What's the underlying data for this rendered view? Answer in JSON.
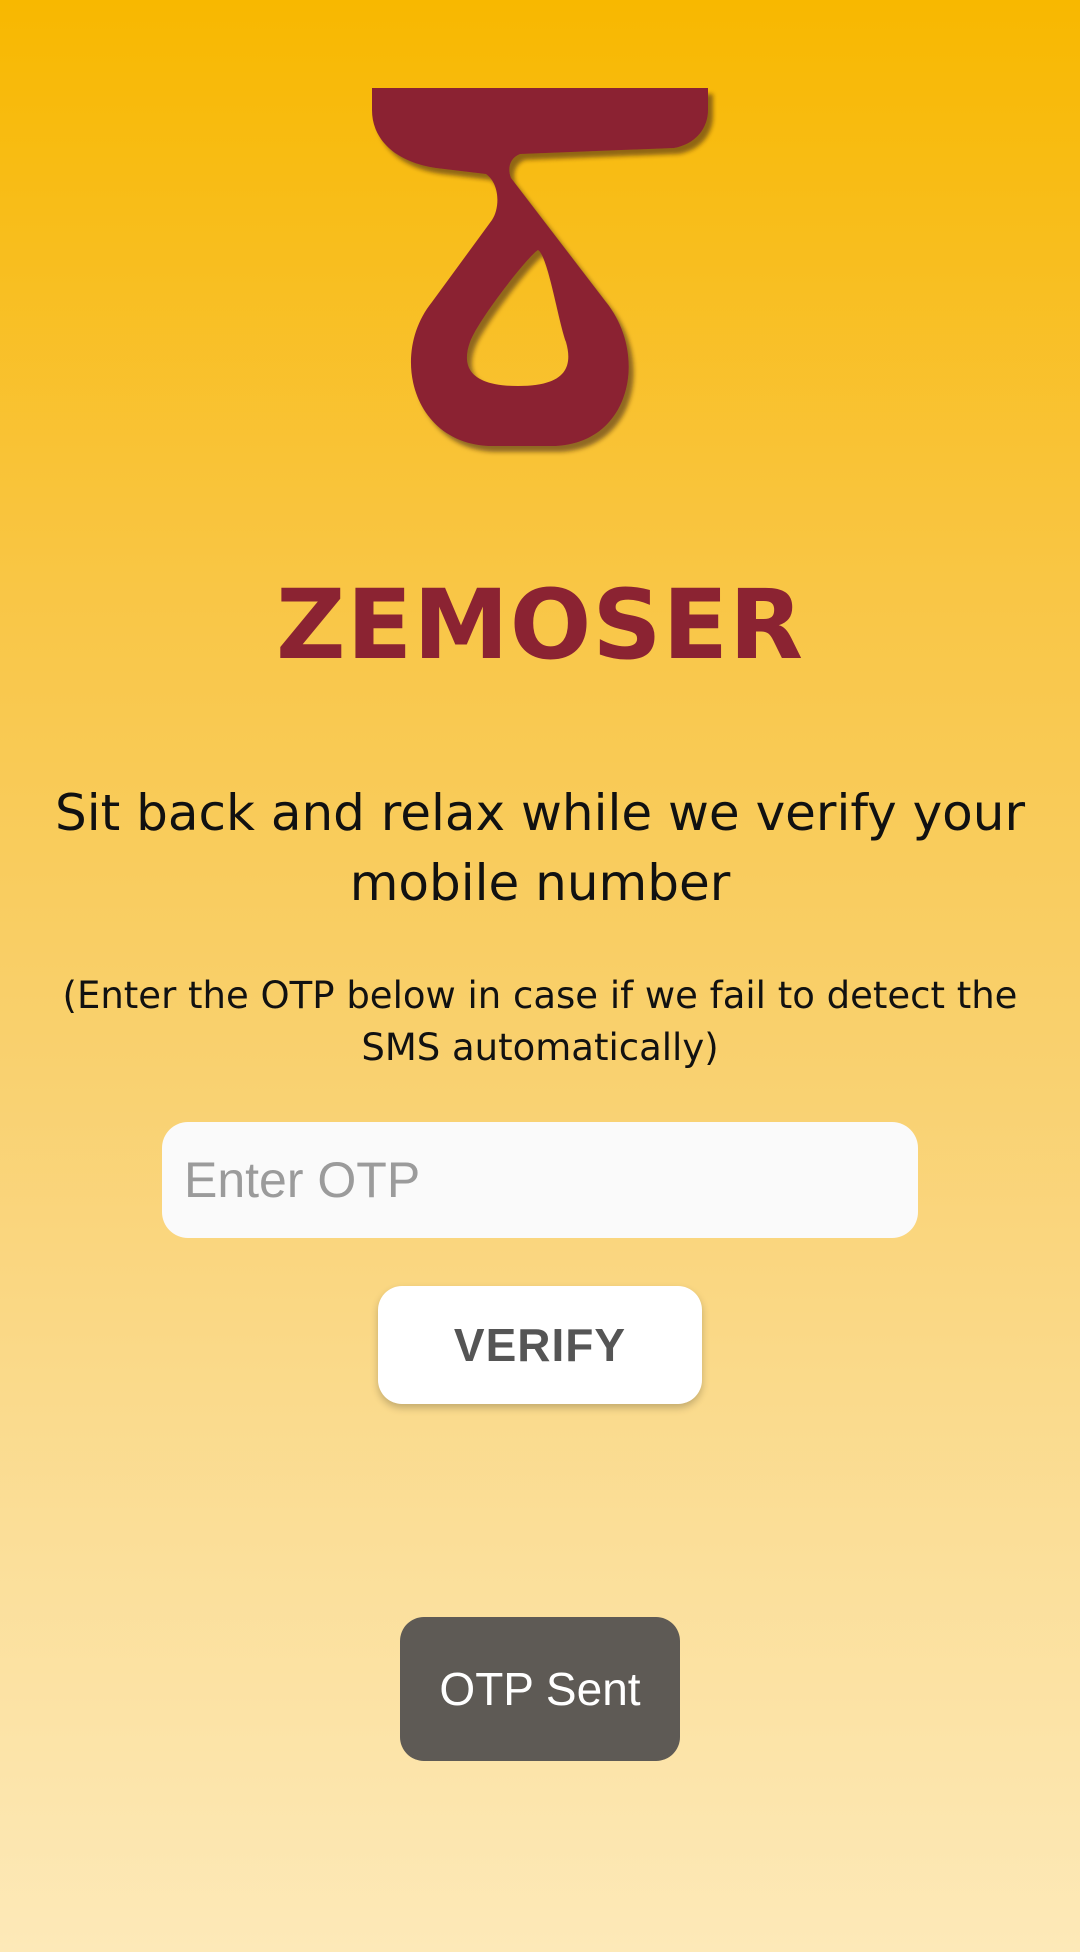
{
  "logo": {
    "icon": "zemoser-logo-icon",
    "color": "#8b2332"
  },
  "brand": {
    "name": "ZEMOSER",
    "color": "#8b2332"
  },
  "verification": {
    "headline": "Sit back and relax while we verify your mobile number",
    "subtext": "(Enter the OTP below in case if we fail to detect the SMS automatically)",
    "otp_placeholder": "Enter OTP",
    "otp_value": "",
    "verify_label": "VERIFY"
  },
  "toast": {
    "message": "OTP Sent"
  },
  "colors": {
    "background_top": "#f8b800",
    "background_bottom": "#fde9b8",
    "toast_background": "#5e5a55"
  }
}
